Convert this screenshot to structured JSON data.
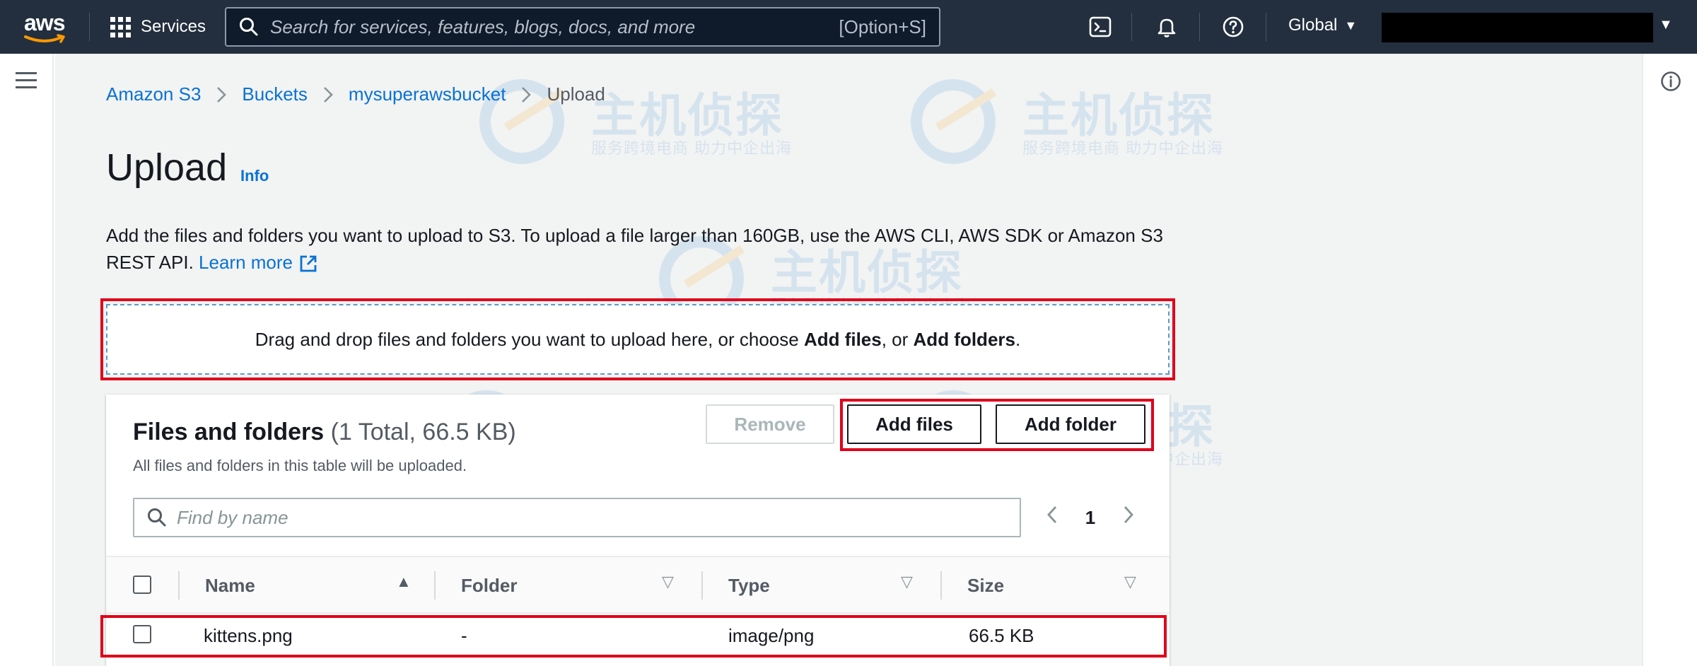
{
  "nav": {
    "logo_text": "aws",
    "services_label": "Services",
    "search_placeholder": "Search for services, features, blogs, docs, and more",
    "search_shortcut": "[Option+S]",
    "region_label": "Global"
  },
  "breadcrumb": {
    "items": [
      "Amazon S3",
      "Buckets",
      "mysuperawsbucket"
    ],
    "current": "Upload"
  },
  "page": {
    "title": "Upload",
    "info_label": "Info",
    "description": "Add the files and folders you want to upload to S3. To upload a file larger than 160GB, use the AWS CLI, AWS SDK or Amazon S3 REST API.",
    "learn_more_label": "Learn more"
  },
  "dropzone": {
    "text_before": "Drag and drop files and folders you want to upload here, or choose ",
    "add_files_bold": "Add files",
    "text_middle": ", or ",
    "add_folders_bold": "Add folders",
    "text_after": "."
  },
  "files_panel": {
    "title": "Files and folders",
    "count_label": "(1 Total, 66.5 KB)",
    "subtitle": "All files and folders in this table will be uploaded.",
    "remove_label": "Remove",
    "add_files_label": "Add files",
    "add_folder_label": "Add folder",
    "find_placeholder": "Find by name",
    "page_number": "1",
    "columns": [
      "Name",
      "Folder",
      "Type",
      "Size"
    ],
    "rows": [
      {
        "name": "kittens.png",
        "folder": "-",
        "type": "image/png",
        "size": "66.5 KB"
      }
    ]
  },
  "watermark": {
    "brand": "主机侦探",
    "tagline": "服务跨境电商  助力中企出海"
  },
  "colors": {
    "nav_bg": "#232f3e",
    "link": "#0972d3",
    "highlight": "#e0001a",
    "page_bg": "#f2f3f3"
  }
}
